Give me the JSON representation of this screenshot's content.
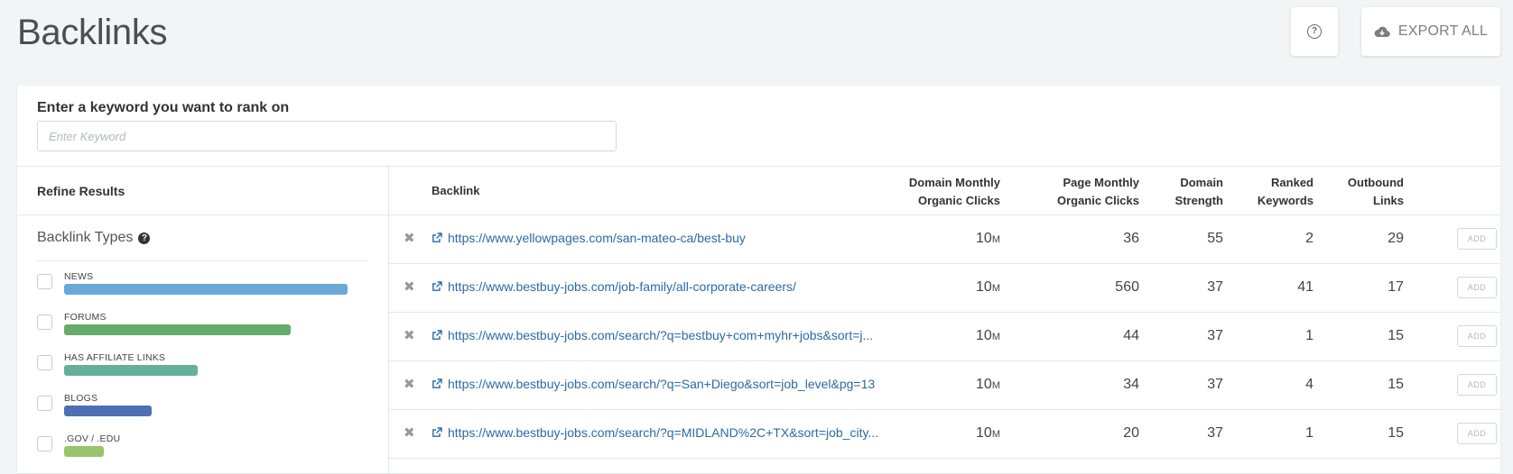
{
  "header": {
    "title": "Backlinks",
    "export_label": "EXPORT ALL"
  },
  "keyword": {
    "label": "Enter a keyword you want to rank on",
    "placeholder": "Enter Keyword",
    "value": ""
  },
  "sidebar": {
    "refine_title": "Refine Results",
    "types_title": "Backlink Types",
    "types": [
      {
        "label": "NEWS",
        "fraction": 1.0,
        "color": "#6aa9d6"
      },
      {
        "label": "FORUMS",
        "fraction": 0.8,
        "color": "#66ab6b"
      },
      {
        "label": "HAS AFFILIATE LINKS",
        "fraction": 0.47,
        "color": "#65b09b"
      },
      {
        "label": "BLOGS",
        "fraction": 0.31,
        "color": "#4e6fb5"
      },
      {
        "label": ".GOV / .EDU",
        "fraction": 0.14,
        "color": "#98c46b"
      }
    ]
  },
  "table": {
    "headers": {
      "backlink": "Backlink",
      "domain_clicks_1": "Domain Monthly",
      "domain_clicks_2": "Organic Clicks",
      "page_clicks_1": "Page Monthly",
      "page_clicks_2": "Organic Clicks",
      "strength_1": "Domain",
      "strength_2": "Strength",
      "ranked_1": "Ranked",
      "ranked_2": "Keywords",
      "outbound_1": "Outbound",
      "outbound_2": "Links"
    },
    "add_label": "ADD",
    "rows": [
      {
        "url": "https://www.yellowpages.com/san-mateo-ca/best-buy",
        "domain_clicks": "10",
        "domain_unit": "M",
        "page_clicks": "36",
        "strength": "55",
        "ranked": "2",
        "outbound": "29"
      },
      {
        "url": "https://www.bestbuy-jobs.com/job-family/all-corporate-careers/",
        "domain_clicks": "10",
        "domain_unit": "M",
        "page_clicks": "560",
        "strength": "37",
        "ranked": "41",
        "outbound": "17"
      },
      {
        "url": "https://www.bestbuy-jobs.com/search/?q=bestbuy+com+myhr+jobs&sort=j...",
        "domain_clicks": "10",
        "domain_unit": "M",
        "page_clicks": "44",
        "strength": "37",
        "ranked": "1",
        "outbound": "15"
      },
      {
        "url": "https://www.bestbuy-jobs.com/search/?q=San+Diego&sort=job_level&pg=13",
        "domain_clicks": "10",
        "domain_unit": "M",
        "page_clicks": "34",
        "strength": "37",
        "ranked": "4",
        "outbound": "15"
      },
      {
        "url": "https://www.bestbuy-jobs.com/search/?q=MIDLAND%2C+TX&sort=job_city...",
        "domain_clicks": "10",
        "domain_unit": "M",
        "page_clicks": "20",
        "strength": "37",
        "ranked": "1",
        "outbound": "15"
      }
    ]
  }
}
